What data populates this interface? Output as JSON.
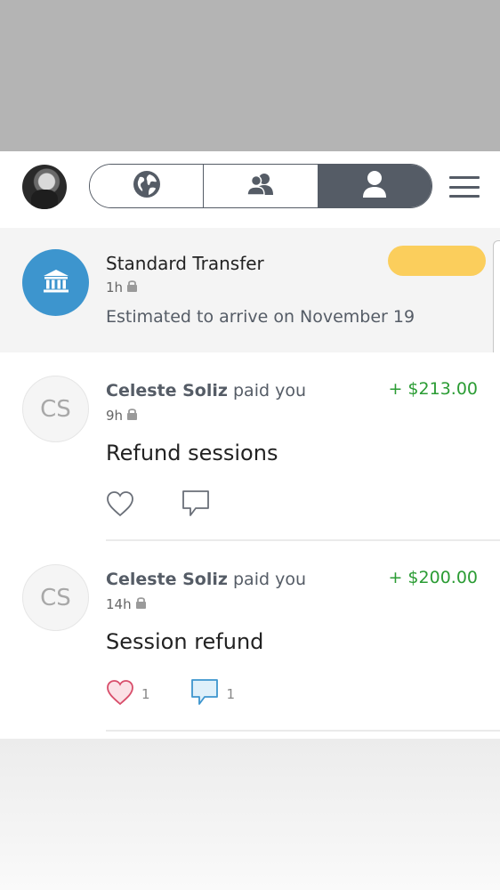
{
  "tabs": {
    "public": "globe-icon",
    "friends": "friends-icon",
    "mine": "person-icon",
    "active": "mine"
  },
  "transfer": {
    "title": "Standard Transfer",
    "time": "1h",
    "subtitle": "Estimated to arrive on November 19"
  },
  "feed": [
    {
      "initials": "CS",
      "name": "Celeste Soliz",
      "action": "paid you",
      "amount": "+ $213.00",
      "time": "9h",
      "note": "Refund sessions",
      "likes": "",
      "comments": ""
    },
    {
      "initials": "CS",
      "name": "Celeste Soliz",
      "action": "paid you",
      "amount": "+ $200.00",
      "time": "14h",
      "note": "Session refund",
      "likes": "1",
      "comments": "1"
    }
  ],
  "colors": {
    "accent": "#3d95ce",
    "positive": "#2b9c34",
    "segment": "#555c66"
  }
}
